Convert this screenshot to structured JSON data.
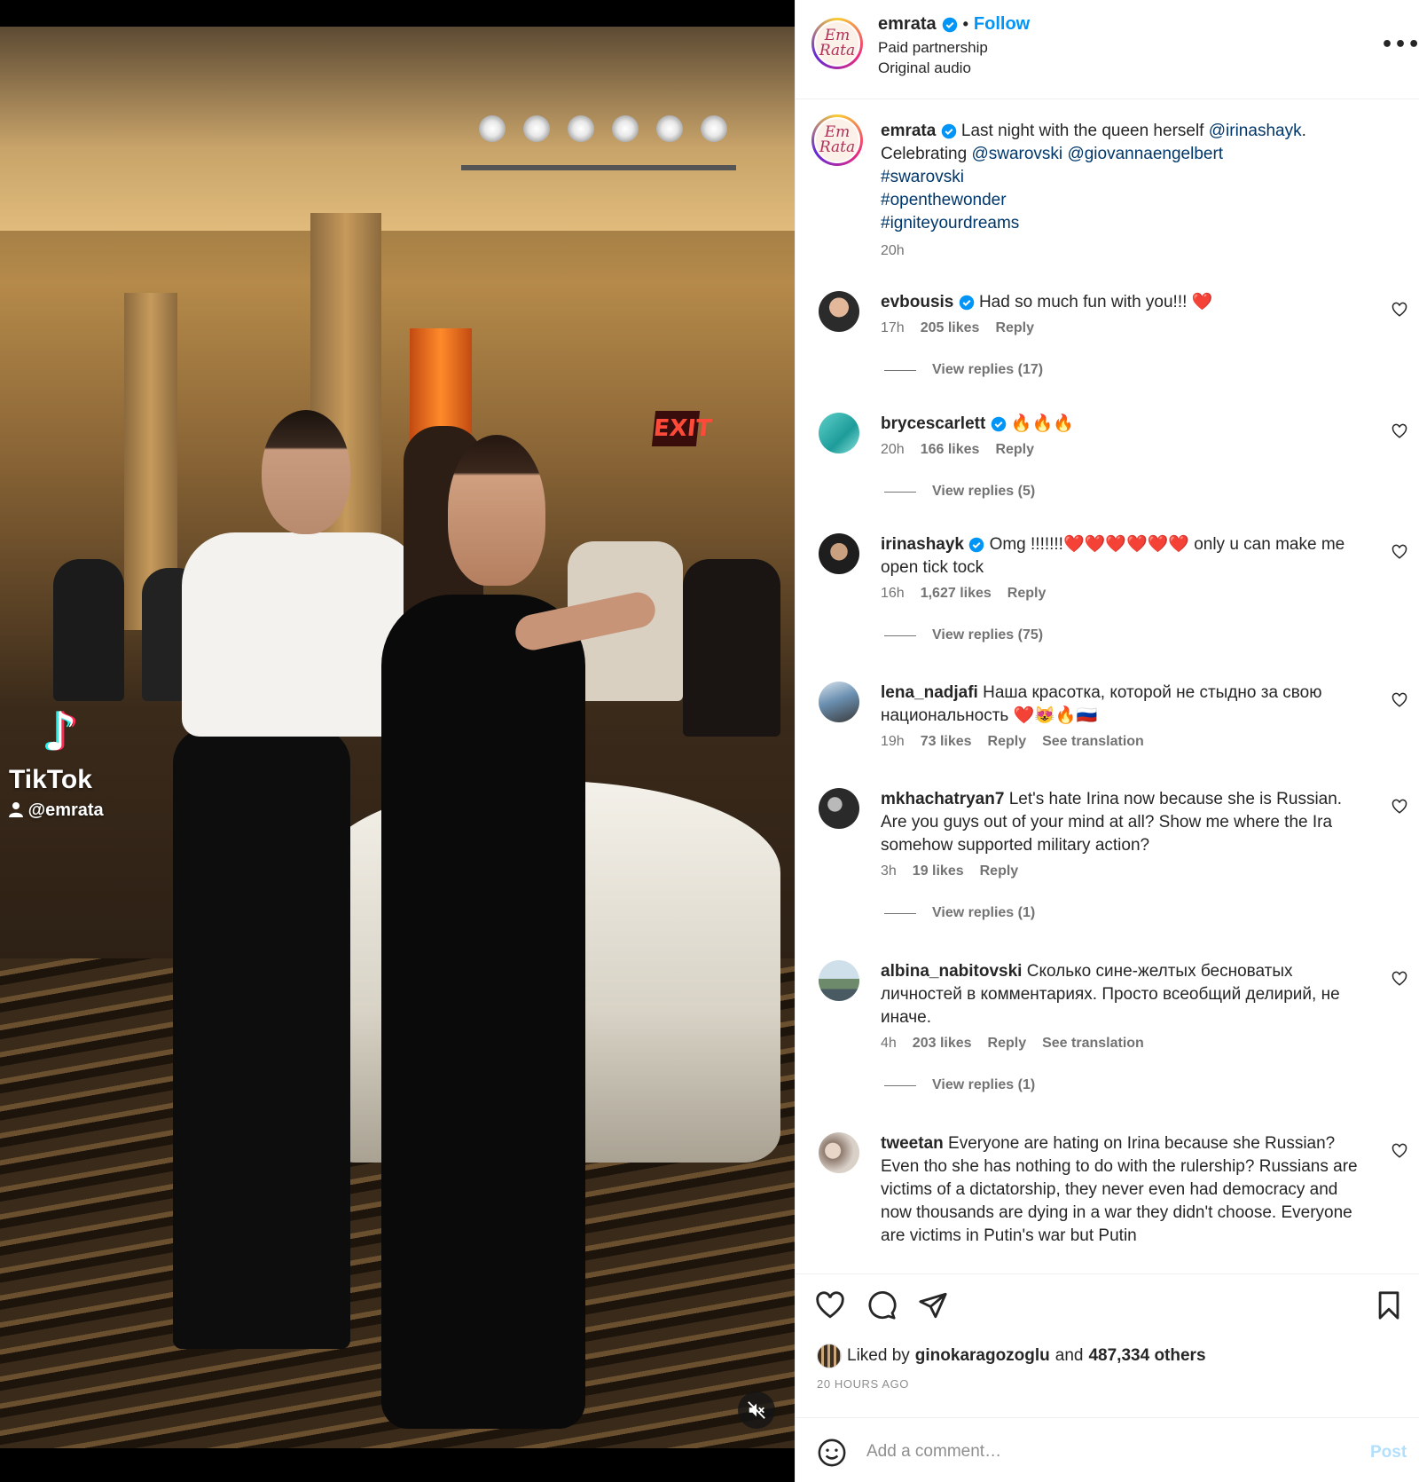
{
  "media": {
    "tiktok_word": "TikTok",
    "tiktok_user": "@emrata",
    "exit_sign": "EXIT",
    "mute_icon": "speaker-muted-icon"
  },
  "header": {
    "avatar_logo": "Em Rata",
    "username": "emrata",
    "verified_icon": "verified-badge-icon",
    "separator": "•",
    "follow": "Follow",
    "line1": "Paid partnership",
    "line2": "Original audio",
    "more_icon": "more-options-icon",
    "more_glyph": "•••"
  },
  "caption": {
    "username": "emrata",
    "text_1": "Last night with the queen herself",
    "mention_1": "@irinashayk",
    "text_2": ".",
    "text_3": "Celebrating",
    "mention_2": "@swarovski",
    "mention_3": "@giovannaengelbert",
    "hashtags": [
      "#swarovski",
      "#openthewonder",
      "#igniteyourdreams"
    ],
    "time": "20h"
  },
  "comments": [
    {
      "username": "evbousis",
      "verified": true,
      "text": "Had so much fun with you!!! ❤️",
      "time": "17h",
      "likes": "205 likes",
      "reply": "Reply",
      "view_replies": "View replies (17)"
    },
    {
      "username": "brycescarlett",
      "verified": true,
      "text": "🔥🔥🔥",
      "time": "20h",
      "likes": "166 likes",
      "reply": "Reply",
      "view_replies": "View replies (5)"
    },
    {
      "username": "irinashayk",
      "verified": true,
      "text": "Omg !!!!!!!❤️❤️❤️❤️❤️❤️ only u can make me open tick tock",
      "time": "16h",
      "likes": "1,627 likes",
      "reply": "Reply",
      "view_replies": "View replies (75)"
    },
    {
      "username": "lena_nadjafi",
      "verified": false,
      "text": "Наша красотка, которой не стыдно за свою национальность ❤️😻🔥🇷🇺",
      "time": "19h",
      "likes": "73 likes",
      "reply": "Reply",
      "see_translation": "See translation"
    },
    {
      "username": "mkhachatryan7",
      "verified": false,
      "text": "Let's hate Irina now because she is Russian. Are you guys out of your mind at all? Show me where the Ira somehow supported military action?",
      "time": "3h",
      "likes": "19 likes",
      "reply": "Reply",
      "view_replies": "View replies (1)"
    },
    {
      "username": "albina_nabitovski",
      "verified": false,
      "text": "Сколько сине-желтых бесноватых личностей в комментариях. Просто всеобщий делирий, не иначе.",
      "time": "4h",
      "likes": "203 likes",
      "reply": "Reply",
      "see_translation": "See translation",
      "view_replies": "View replies (1)"
    },
    {
      "username": "tweetan",
      "verified": false,
      "text": "Everyone are hating on Irina because she Russian? Even tho she has nothing to do with the rulership? Russians are victims of a dictatorship, they never even had democracy and now thousands are dying in a war they didn't choose. Everyone are victims in Putin's war but Putin"
    }
  ],
  "actions": {
    "like_icon": "heart-icon",
    "comment_icon": "comment-icon",
    "share_icon": "send-icon",
    "save_icon": "bookmark-icon",
    "liked_by": "Liked by",
    "liked_user": "ginokaragozoglu",
    "and": "and",
    "others": "487,334 others",
    "post_time": "20 HOURS AGO"
  },
  "composer": {
    "emoji_icon": "emoji-icon",
    "placeholder": "Add a comment…",
    "post": "Post"
  },
  "colors": {
    "accent": "#0095f6",
    "link": "#00376b",
    "muted": "#737373",
    "like_red": "#ed4956"
  }
}
